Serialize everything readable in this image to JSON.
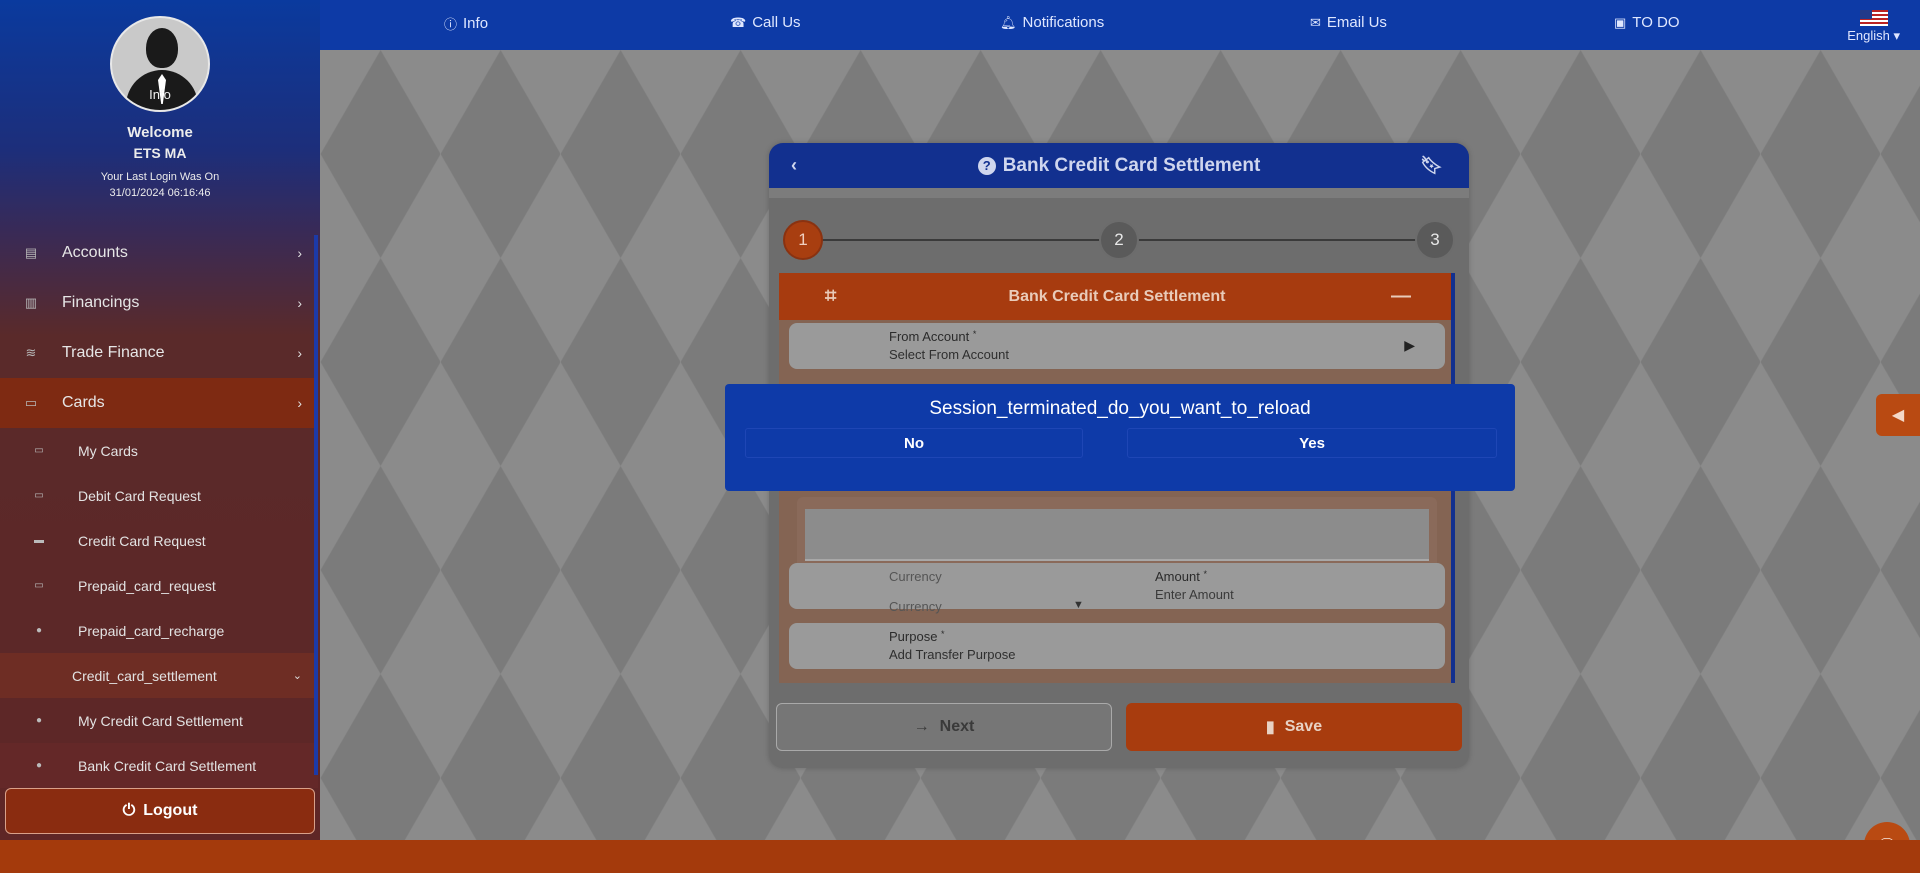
{
  "topbar": {
    "items": [
      {
        "label": "Info",
        "icon": "info-icon"
      },
      {
        "label": "Call Us",
        "icon": "phone-person-icon"
      },
      {
        "label": "Notifications",
        "icon": "bell-icon"
      },
      {
        "label": "Email Us",
        "icon": "email-icon"
      },
      {
        "label": "TO DO",
        "icon": "todo-icon"
      }
    ],
    "language": "English"
  },
  "sidebar": {
    "avatar_caption": "Info",
    "welcome": "Welcome",
    "user": "ETS MA",
    "last_login_label": "Your Last Login Was On",
    "last_login": "31/01/2024 06:16:46",
    "menu": [
      {
        "label": "Accounts",
        "icon": "accounts-icon"
      },
      {
        "label": "Financings",
        "icon": "chart-icon"
      },
      {
        "label": "Trade Finance",
        "icon": "handshake-icon"
      },
      {
        "label": "Cards",
        "icon": "card-icon"
      }
    ],
    "cards_submenu": [
      "My Cards",
      "Debit Card Request",
      "Credit Card Request",
      "Prepaid_card_request",
      "Prepaid_card_recharge"
    ],
    "active_item": "Credit_card_settlement",
    "settlement_submenu": [
      "My Credit Card Settlement",
      "Bank Credit Card Settlement"
    ],
    "logout": "Logout"
  },
  "card": {
    "title": "Bank Credit Card Settlement",
    "steps": [
      "1",
      "2",
      "3"
    ],
    "current_step": 1,
    "section_title": "Bank Credit Card Settlement",
    "from_account": {
      "label": "From Account",
      "value": "Select From Account"
    },
    "currency": {
      "label": "Currency",
      "placeholder": "Currency"
    },
    "amount": {
      "label": "Amount",
      "placeholder": "Enter Amount"
    },
    "purpose": {
      "label": "Purpose",
      "placeholder": "Add Transfer Purpose"
    },
    "required_mark": "*",
    "next": "Next",
    "save": "Save"
  },
  "modal": {
    "message": "Session_terminated_do_you_want_to_reload",
    "no": "No",
    "yes": "Yes"
  },
  "colors": {
    "brand_blue": "#0d3aa6",
    "brand_orange": "#a83c0e"
  }
}
